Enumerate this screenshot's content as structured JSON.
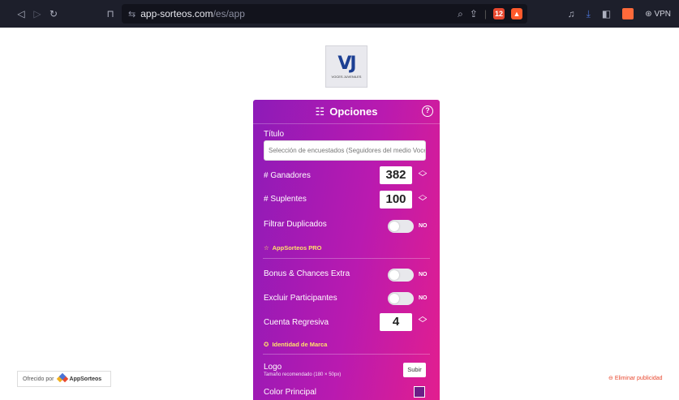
{
  "browser": {
    "url_host": "app-sorteos.com",
    "url_path": "/es/app",
    "vpn_label": "VPN",
    "ext_badge_count": "12"
  },
  "logo": {
    "initials": "VJ",
    "tag_line": "VOCES JUVENILES"
  },
  "panel": {
    "title": "Opciones",
    "titulo_label": "Título",
    "titulo_value": "Selección de encuestados (Seguidores del medio Voces Juveniles)",
    "ganadores_label": "# Ganadores",
    "ganadores_value": "382",
    "suplentes_label": "# Suplentes",
    "suplentes_value": "100",
    "filtrar_label": "Filtrar Duplicados",
    "filtrar_toggle": "NO",
    "pro_label": "AppSorteos PRO",
    "bonus_label": "Bonus & Chances Extra",
    "bonus_toggle": "NO",
    "excluir_label": "Excluir Participantes",
    "excluir_toggle": "NO",
    "cuenta_label": "Cuenta Regresiva",
    "cuenta_value": "4",
    "identidad_label": "Identidad de Marca",
    "logo_label": "Logo",
    "logo_hint": "Tamaño recomendado (180 × 50px)",
    "subir_label": "Subir",
    "color_label": "Color Principal"
  },
  "footer": {
    "powered_by": "Ofrecido por",
    "brand": "AppSorteos",
    "remove_ads": "Eliminar publicidad"
  },
  "colors": {
    "panel_start": "#8d1bb8",
    "panel_end": "#e21e8f",
    "accent_yellow": "#ffe16a",
    "ads_red": "#e8482f"
  }
}
